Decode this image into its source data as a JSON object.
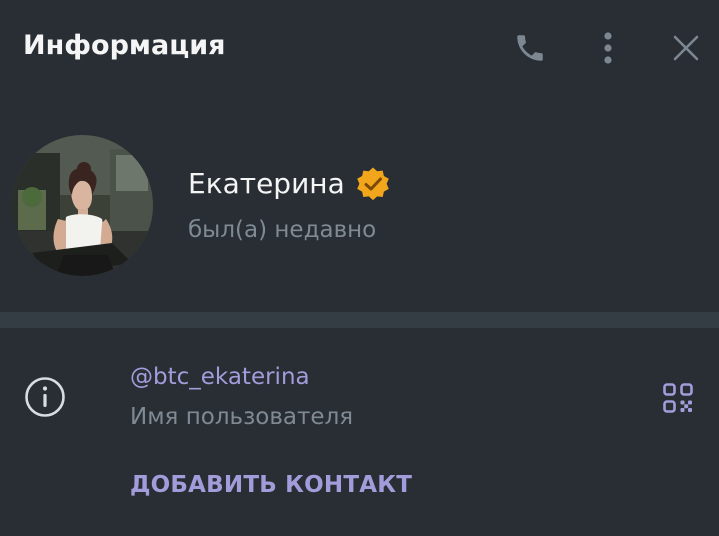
{
  "header": {
    "title": "Информация",
    "icons": [
      "phone-icon",
      "more-vertical-icon",
      "close-icon"
    ]
  },
  "profile": {
    "name": "Екатерина",
    "status": "был(а) недавно",
    "verified_icon": "verified-badge-icon"
  },
  "info": {
    "username": "@btc_ekaterina",
    "username_label": "Имя пользователя",
    "add_contact_label": "ДОБАВИТЬ КОНТАКТ",
    "icons": [
      "info-icon",
      "qr-code-icon"
    ]
  },
  "colors": {
    "background": "#282e33",
    "divider": "#343d44",
    "text_primary": "#f5f5f5",
    "text_secondary": "#7f8a94",
    "accent": "#a39cdb",
    "icon": "#7d8791",
    "badge": "#f2a61c"
  }
}
